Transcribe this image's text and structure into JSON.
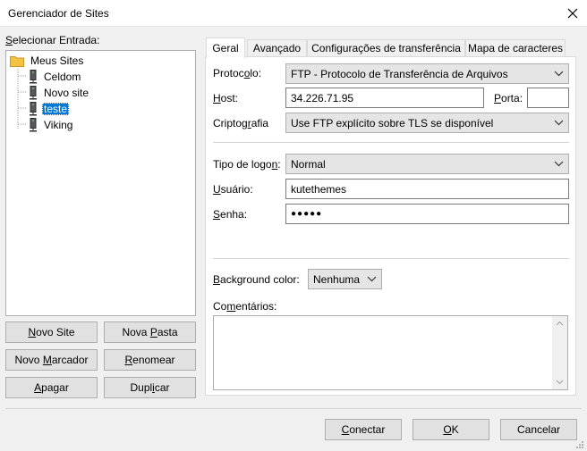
{
  "window": {
    "title": "Gerenciador de Sites",
    "close_label": "✕"
  },
  "left": {
    "select_label_prefix": "",
    "select_label_mnemonic": "S",
    "select_label_rest": "elecionar Entrada:",
    "tree": {
      "root": "Meus Sites",
      "items": [
        "Celdom",
        "Novo site",
        "teste",
        "Viking"
      ],
      "selected": "teste"
    },
    "buttons": {
      "new_site": {
        "pre": "",
        "m": "N",
        "post": "ovo Site"
      },
      "new_folder": {
        "pre": "Nova ",
        "m": "P",
        "post": "asta"
      },
      "new_bookmark": {
        "pre": "Novo ",
        "m": "M",
        "post": "arcador"
      },
      "rename": {
        "pre": "",
        "m": "R",
        "post": "enomear"
      },
      "delete": {
        "pre": "",
        "m": "A",
        "post": "pagar"
      },
      "duplicate": {
        "pre": "Dupl",
        "m": "i",
        "post": "car"
      }
    }
  },
  "tabs": [
    "Geral",
    "Avançado",
    "Configurações de transferência",
    "Mapa de caracteres"
  ],
  "general": {
    "protocol": {
      "label_pre": "Protoc",
      "label_m": "o",
      "label_post": "lo:",
      "value": "FTP - Protocolo de Transferência de Arquivos"
    },
    "host": {
      "label_pre": "",
      "label_m": "H",
      "label_post": "ost:",
      "value": "34.226.71.95"
    },
    "port": {
      "label_pre": "",
      "label_m": "P",
      "label_post": "orta:",
      "value": ""
    },
    "encryption": {
      "label_pre": "Criptog",
      "label_m": "r",
      "label_post": "afia",
      "value": "Use FTP explícito sobre TLS se disponível"
    },
    "logon_type": {
      "label_pre": "Tipo de logo",
      "label_m": "n",
      "label_post": ":",
      "value": "Normal"
    },
    "user": {
      "label_pre": "",
      "label_m": "U",
      "label_post": "suário:",
      "value": "kutethemes"
    },
    "password": {
      "label_pre": "",
      "label_m": "S",
      "label_post": "enha:",
      "value": "●●●●●"
    },
    "bg_color": {
      "label_pre": "",
      "label_m": "B",
      "label_post": "ackground color:",
      "value": "Nenhuma"
    },
    "comments": {
      "label_pre": "Co",
      "label_m": "m",
      "label_post": "entários:"
    }
  },
  "footer": {
    "connect": {
      "pre": "",
      "m": "C",
      "post": "onectar"
    },
    "ok": {
      "pre": "",
      "m": "O",
      "post": "K"
    },
    "cancel": {
      "label": "Cancelar"
    }
  },
  "colors": {
    "selection": "#0078d7",
    "folder": "#f5c342"
  }
}
